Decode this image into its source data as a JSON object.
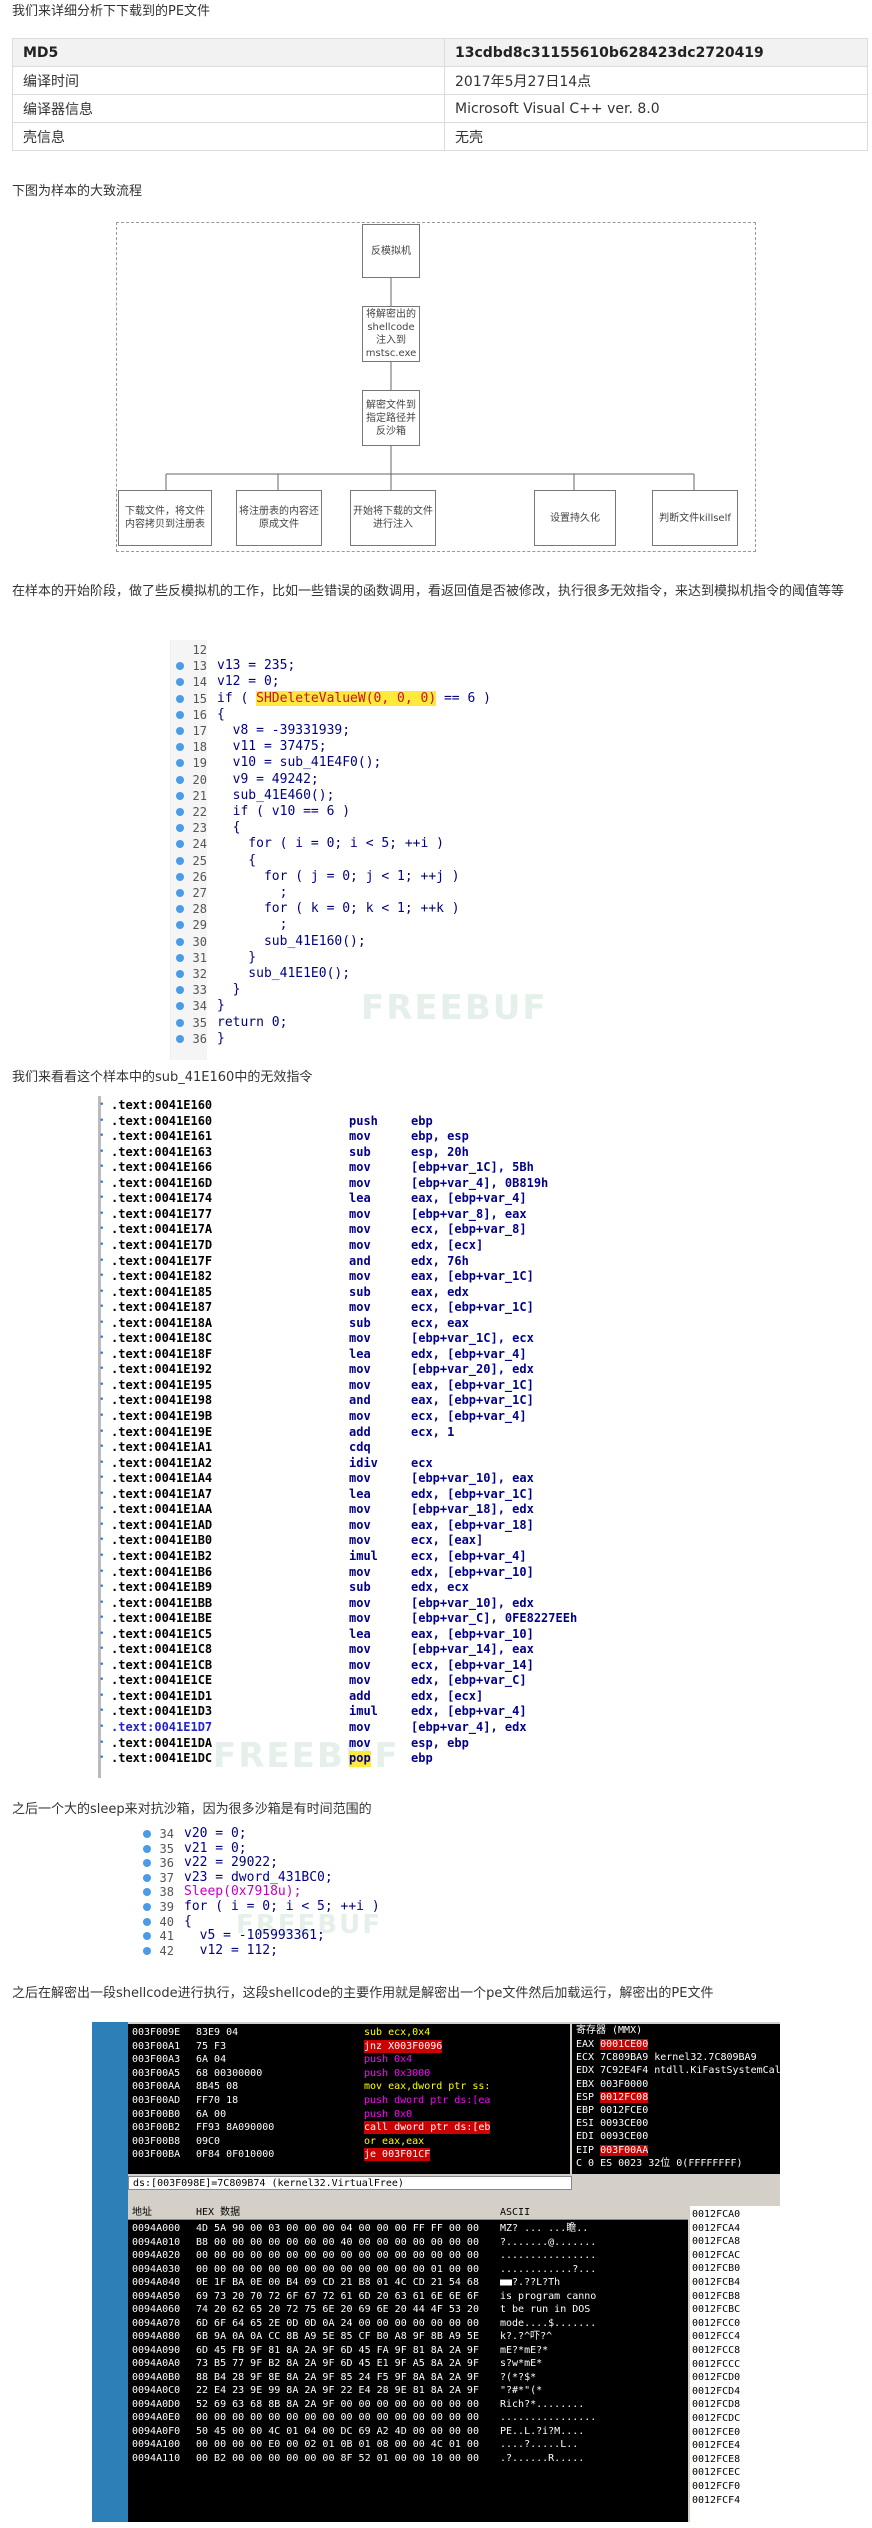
{
  "intro": "我们来详细分析下下载到的PE文件",
  "info_table": {
    "rows": [
      {
        "key": "MD5",
        "value": "13cdbd8c31155610b628423dc2720419"
      },
      {
        "key": "编译时间",
        "value": "2017年5月27日14点"
      },
      {
        "key": "编译器信息",
        "value": "Microsoft Visual C++ ver. 8.0"
      },
      {
        "key": "壳信息",
        "value": "无壳"
      }
    ]
  },
  "flow_intro": "下图为样本的大致流程",
  "flowchart": {
    "step1": "反模拟机",
    "step2": "将解密出的shellcode注入到mstsc.exe",
    "step3": "解密文件到指定路径并反沙箱",
    "leaf1": "下载文件，将文件内容拷贝到注册表",
    "leaf2": "将注册表的内容还原成文件",
    "leaf3": "开始将下载的文件进行注入",
    "leaf4": "设置持久化",
    "leaf5": "判断文件killself"
  },
  "para_antiemu": "在样本的开始阶段，做了些反模拟机的工作，比如一些错误的函数调用，看返回值是否被修改，执行很多无效指令，来达到模拟机指令的阈值等等",
  "code1": [
    {
      "ln": "12",
      "text": ""
    },
    {
      "ln": "13",
      "text": "v13 = 235;"
    },
    {
      "ln": "14",
      "text": "v12 = 0;"
    },
    {
      "ln": "15",
      "text": "if ( SHDeleteValueW(0, 0, 0) == 6 )"
    },
    {
      "ln": "16",
      "text": "{"
    },
    {
      "ln": "17",
      "text": "  v8 = -39331939;"
    },
    {
      "ln": "18",
      "text": "  v11 = 37475;"
    },
    {
      "ln": "19",
      "text": "  v10 = sub_41E4F0();"
    },
    {
      "ln": "20",
      "text": "  v9 = 49242;"
    },
    {
      "ln": "21",
      "text": "  sub_41E460();"
    },
    {
      "ln": "22",
      "text": "  if ( v10 == 6 )"
    },
    {
      "ln": "23",
      "text": "  {"
    },
    {
      "ln": "24",
      "text": "    for ( i = 0; i < 5; ++i )"
    },
    {
      "ln": "25",
      "text": "    {"
    },
    {
      "ln": "26",
      "text": "      for ( j = 0; j < 1; ++j )"
    },
    {
      "ln": "27",
      "text": "        ;"
    },
    {
      "ln": "28",
      "text": "      for ( k = 0; k < 1; ++k )"
    },
    {
      "ln": "29",
      "text": "        ;"
    },
    {
      "ln": "30",
      "text": "      sub_41E160();"
    },
    {
      "ln": "31",
      "text": "    }"
    },
    {
      "ln": "32",
      "text": "    sub_41E1E0();"
    },
    {
      "ln": "33",
      "text": "  }"
    },
    {
      "ln": "34",
      "text": "}"
    },
    {
      "ln": "35",
      "text": "return 0;"
    },
    {
      "ln": "36",
      "text": "}"
    }
  ],
  "code1_hl": "SHDeleteValueW(0, 0, 0)",
  "watermark": "FREEBUF",
  "para_sub": "我们来看看这个样本中的sub_41E160中的无效指令",
  "code2": [
    {
      "addr": ".text:0041E160",
      "mn": "",
      "op": ""
    },
    {
      "addr": ".text:0041E160",
      "mn": "push",
      "op": "ebp"
    },
    {
      "addr": ".text:0041E161",
      "mn": "mov",
      "op": "ebp, esp"
    },
    {
      "addr": ".text:0041E163",
      "mn": "sub",
      "op": "esp, 20h"
    },
    {
      "addr": ".text:0041E166",
      "mn": "mov",
      "op": "[ebp+var_1C], 5Bh"
    },
    {
      "addr": ".text:0041E16D",
      "mn": "mov",
      "op": "[ebp+var_4], 0B819h"
    },
    {
      "addr": ".text:0041E174",
      "mn": "lea",
      "op": "eax, [ebp+var_4]"
    },
    {
      "addr": ".text:0041E177",
      "mn": "mov",
      "op": "[ebp+var_8], eax"
    },
    {
      "addr": ".text:0041E17A",
      "mn": "mov",
      "op": "ecx, [ebp+var_8]"
    },
    {
      "addr": ".text:0041E17D",
      "mn": "mov",
      "op": "edx, [ecx]"
    },
    {
      "addr": ".text:0041E17F",
      "mn": "and",
      "op": "edx, 76h"
    },
    {
      "addr": ".text:0041E182",
      "mn": "mov",
      "op": "eax, [ebp+var_1C]"
    },
    {
      "addr": ".text:0041E185",
      "mn": "sub",
      "op": "eax, edx"
    },
    {
      "addr": ".text:0041E187",
      "mn": "mov",
      "op": "ecx, [ebp+var_1C]"
    },
    {
      "addr": ".text:0041E18A",
      "mn": "sub",
      "op": "ecx, eax"
    },
    {
      "addr": ".text:0041E18C",
      "mn": "mov",
      "op": "[ebp+var_1C], ecx"
    },
    {
      "addr": ".text:0041E18F",
      "mn": "lea",
      "op": "edx, [ebp+var_4]"
    },
    {
      "addr": ".text:0041E192",
      "mn": "mov",
      "op": "[ebp+var_20], edx"
    },
    {
      "addr": ".text:0041E195",
      "mn": "mov",
      "op": "eax, [ebp+var_1C]"
    },
    {
      "addr": ".text:0041E198",
      "mn": "and",
      "op": "eax, [ebp+var_1C]"
    },
    {
      "addr": ".text:0041E19B",
      "mn": "mov",
      "op": "ecx, [ebp+var_4]"
    },
    {
      "addr": ".text:0041E19E",
      "mn": "add",
      "op": "ecx, 1"
    },
    {
      "addr": ".text:0041E1A1",
      "mn": "cdq",
      "op": ""
    },
    {
      "addr": ".text:0041E1A2",
      "mn": "idiv",
      "op": "ecx"
    },
    {
      "addr": ".text:0041E1A4",
      "mn": "mov",
      "op": "[ebp+var_10], eax"
    },
    {
      "addr": ".text:0041E1A7",
      "mn": "lea",
      "op": "edx, [ebp+var_1C]"
    },
    {
      "addr": ".text:0041E1AA",
      "mn": "mov",
      "op": "[ebp+var_18], edx"
    },
    {
      "addr": ".text:0041E1AD",
      "mn": "mov",
      "op": "eax, [ebp+var_18]"
    },
    {
      "addr": ".text:0041E1B0",
      "mn": "mov",
      "op": "ecx, [eax]"
    },
    {
      "addr": ".text:0041E1B2",
      "mn": "imul",
      "op": "ecx, [ebp+var_4]"
    },
    {
      "addr": ".text:0041E1B6",
      "mn": "mov",
      "op": "edx, [ebp+var_10]"
    },
    {
      "addr": ".text:0041E1B9",
      "mn": "sub",
      "op": "edx, ecx"
    },
    {
      "addr": ".text:0041E1BB",
      "mn": "mov",
      "op": "[ebp+var_10], edx"
    },
    {
      "addr": ".text:0041E1BE",
      "mn": "mov",
      "op": "[ebp+var_C], 0FE8227EEh"
    },
    {
      "addr": ".text:0041E1C5",
      "mn": "lea",
      "op": "eax, [ebp+var_10]"
    },
    {
      "addr": ".text:0041E1C8",
      "mn": "mov",
      "op": "[ebp+var_14], eax"
    },
    {
      "addr": ".text:0041E1CB",
      "mn": "mov",
      "op": "ecx, [ebp+var_14]"
    },
    {
      "addr": ".text:0041E1CE",
      "mn": "mov",
      "op": "edx, [ebp+var_C]"
    },
    {
      "addr": ".text:0041E1D1",
      "mn": "add",
      "op": "edx, [ecx]"
    },
    {
      "addr": ".text:0041E1D3",
      "mn": "imul",
      "op": "edx, [ebp+var_4]"
    },
    {
      "addr": ".text:0041E1D7",
      "mn": "mov",
      "op": "[ebp+var_4], edx"
    },
    {
      "addr": ".text:0041E1DA",
      "mn": "mov",
      "op": "esp, ebp"
    },
    {
      "addr": ".text:0041E1DC",
      "mn": "pop",
      "op": "ebp"
    }
  ],
  "para_sleep": "之后一个大的sleep来对抗沙箱，因为很多沙箱是有时间范围的",
  "code3": [
    {
      "ln": "34",
      "text": "v20 = 0;"
    },
    {
      "ln": "35",
      "text": "v21 = 0;"
    },
    {
      "ln": "36",
      "text": "v22 = 29022;"
    },
    {
      "ln": "37",
      "text": "v23 = dword_431BC0;"
    },
    {
      "ln": "38",
      "text": "Sleep(0x7918u);"
    },
    {
      "ln": "39",
      "text": "for ( i = 0; i < 5; ++i )"
    },
    {
      "ln": "40",
      "text": "{"
    },
    {
      "ln": "41",
      "text": "  v5 = -105993361;"
    },
    {
      "ln": "42",
      "text": "  v12 = 112;"
    }
  ],
  "para_shellcode": "之后在解密出一段shellcode进行执行，这段shellcode的主要作用就是解密出一个pe文件然后加载运行，解密出的PE文件",
  "debugger": {
    "disasm": [
      {
        "a": "003F009E",
        "h": "83E9 04",
        "i": "sub ecx,0x4",
        "c": "y"
      },
      {
        "a": "003F00A1",
        "h": "75 F3",
        "i": "jnz X003F0096",
        "c": "red"
      },
      {
        "a": "003F00A3",
        "h": "6A 04",
        "i": "push 0x4",
        "c": "mg"
      },
      {
        "a": "003F00A5",
        "h": "68 00300000",
        "i": "push 0x3000",
        "c": "mg"
      },
      {
        "a": "003F00AA",
        "h": "8B45 08",
        "i": "mov eax,dword ptr ss:",
        "c": "y"
      },
      {
        "a": "003F00AD",
        "h": "FF70 18",
        "i": "push dword ptr ds:[ea",
        "c": "mg"
      },
      {
        "a": "003F00B0",
        "h": "6A 00",
        "i": "push 0x0",
        "c": "mg"
      },
      {
        "a": "003F00B2",
        "h": "FF93 8A090000",
        "i": "call dword ptr ds:[eb",
        "c": "red"
      },
      {
        "a": "003F00B8",
        "h": "09C0",
        "i": "or eax,eax",
        "c": "y"
      },
      {
        "a": "003F00BA",
        "h": "0F84 0F010000",
        "i": "je 003F01CF",
        "c": "red"
      }
    ],
    "regs_title": "寄存器 (MMX)",
    "regs": [
      {
        "n": "EAX",
        "v": "0001CE00",
        "extra": "",
        "red": true
      },
      {
        "n": "ECX",
        "v": "7C809BA9",
        "extra": "kernel32.7C809BA9",
        "red": false
      },
      {
        "n": "EDX",
        "v": "7C92E4F4",
        "extra": "ntdll.KiFastSystemCallRet",
        "red": false
      },
      {
        "n": "EBX",
        "v": "003F0000",
        "extra": "",
        "red": false
      },
      {
        "n": "ESP",
        "v": "0012FC08",
        "extra": "",
        "red": true
      },
      {
        "n": "EBP",
        "v": "0012FCE0",
        "extra": "",
        "red": false
      },
      {
        "n": "ESI",
        "v": "0093CE00",
        "extra": "",
        "red": false
      },
      {
        "n": "EDI",
        "v": "0093CE00",
        "extra": "",
        "red": false
      },
      {
        "n": "EIP",
        "v": "003F00AA",
        "extra": "",
        "red": true
      },
      {
        "n": "C 0",
        "v": "ES 0023 32位 0(FFFFFFFF)",
        "extra": "",
        "red": false
      }
    ],
    "status": "ds:[003F098E]=7C809B74 (kernel32.VirtualFree)",
    "dump_headers": {
      "addr": "地址",
      "hex": "HEX 数据",
      "ascii": "ASCII"
    },
    "dump": [
      {
        "a": "0094A000",
        "h": "4D 5A 90 00 03 00 00 00 04 00 00 00 FF FF 00 00",
        "s": "MZ? ... ...瞻.."
      },
      {
        "a": "0094A010",
        "h": "B8 00 00 00 00 00 00 00 40 00 00 00 00 00 00 00",
        "s": "?.......@......."
      },
      {
        "a": "0094A020",
        "h": "00 00 00 00 00 00 00 00 00 00 00 00 00 00 00 00",
        "s": "................"
      },
      {
        "a": "0094A030",
        "h": "00 00 00 00 00 00 00 00 00 00 00 00 00 01 00 00",
        "s": "............?..."
      },
      {
        "a": "0094A040",
        "h": "0E 1F BA 0E 00 B4 09 CD 21 B8 01 4C CD 21 54 68",
        "s": "■■?.??L?Th"
      },
      {
        "a": "0094A050",
        "h": "69 73 20 70 72 6F 67 72 61 6D 20 63 61 6E 6E 6F",
        "s": "is program canno"
      },
      {
        "a": "0094A060",
        "h": "74 20 62 65 20 72 75 6E 20 69 6E 20 44 4F 53 20",
        "s": "t be run in DOS "
      },
      {
        "a": "0094A070",
        "h": "6D 6F 64 65 2E 0D 0D 0A 24 00 00 00 00 00 00 00",
        "s": "mode....$......."
      },
      {
        "a": "0094A080",
        "h": "6B 9A 0A 0A CC 8B A9 5E 85 CF B0 A8 9F 8B A9 5E",
        "s": "k?.?^吓?^"
      },
      {
        "a": "0094A090",
        "h": "6D 45 FB 9F 81 8A 2A 9F 6D 45 FA 9F 81 8A 2A 9F",
        "s": "mE?*mE?*"
      },
      {
        "a": "0094A0A0",
        "h": "73 B5 77 9F B2 8A 2A 9F 6D 45 E1 9F A5 8A 2A 9F",
        "s": "s?w*mE*"
      },
      {
        "a": "0094A0B0",
        "h": "88 B4 28 9F 8E 8A 2A 9F 85 24 F5 9F 8A 8A 2A 9F",
        "s": "?(*?$*"
      },
      {
        "a": "0094A0C0",
        "h": "22 E4 23 9E 99 8A 2A 9F 22 E4 28 9E 81 8A 2A 9F",
        "s": "\"?#*\"(*"
      },
      {
        "a": "0094A0D0",
        "h": "52 69 63 68 8B 8A 2A 9F 00 00 00 00 00 00 00 00",
        "s": "Rich?*........"
      },
      {
        "a": "0094A0E0",
        "h": "00 00 00 00 00 00 00 00 00 00 00 00 00 00 00 00",
        "s": "................"
      },
      {
        "a": "0094A0F0",
        "h": "50 45 00 00 4C 01 04 00 DC 69 A2 4D 00 00 00 00",
        "s": "PE..L.?i?M...."
      },
      {
        "a": "0094A100",
        "h": "00 00 00 00 E0 00 02 01 0B 01 08 00 00 4C 01 00",
        "s": "....?.....L.."
      },
      {
        "a": "0094A110",
        "h": "00 B2 00 00 00 00 00 00 8F 52 01 00 00 10 00 00",
        "s": ".?......R....."
      }
    ],
    "stack": [
      "0012FCA0",
      "0012FCA4",
      "0012FCA8",
      "0012FCAC",
      "0012FCB0",
      "0012FCB4",
      "0012FCB8",
      "0012FCBC",
      "0012FCC0",
      "0012FCC4",
      "0012FCC8",
      "0012FCCC",
      "0012FCD0",
      "0012FCD4",
      "0012FCD8",
      "0012FCDC",
      "0012FCE0",
      "0012FCE4",
      "0012FCE8",
      "0012FCEC",
      "0012FCF0",
      "0012FCF4"
    ]
  }
}
